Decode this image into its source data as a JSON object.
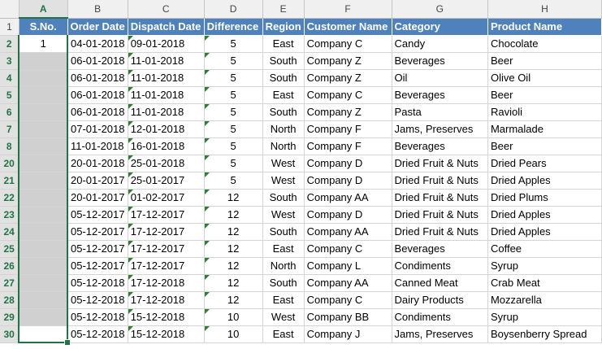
{
  "columns": [
    "A",
    "B",
    "C",
    "D",
    "E",
    "F",
    "G",
    "H"
  ],
  "header_row_number": "1",
  "headers": [
    "S.No.",
    "Order Date",
    "Dispatch Date",
    "Difference",
    "Region",
    "Customer Name",
    "Category",
    "Product Name"
  ],
  "rows": [
    {
      "rownum": "2",
      "sno": "1",
      "order": "04-01-2018",
      "dispatch": "09-01-2018",
      "diff": "5",
      "region": "East",
      "customer": "Company C",
      "category": "Candy",
      "product": "Chocolate"
    },
    {
      "rownum": "3",
      "sno": "",
      "order": "06-01-2018",
      "dispatch": "11-01-2018",
      "diff": "5",
      "region": "South",
      "customer": "Company Z",
      "category": "Beverages",
      "product": "Beer"
    },
    {
      "rownum": "4",
      "sno": "",
      "order": "06-01-2018",
      "dispatch": "11-01-2018",
      "diff": "5",
      "region": "South",
      "customer": "Company Z",
      "category": "Oil",
      "product": "Olive Oil"
    },
    {
      "rownum": "5",
      "sno": "",
      "order": "06-01-2018",
      "dispatch": "11-01-2018",
      "diff": "5",
      "region": "East",
      "customer": "Company C",
      "category": "Beverages",
      "product": "Beer"
    },
    {
      "rownum": "6",
      "sno": "",
      "order": "06-01-2018",
      "dispatch": "11-01-2018",
      "diff": "5",
      "region": "South",
      "customer": "Company Z",
      "category": "Pasta",
      "product": "Ravioli"
    },
    {
      "rownum": "7",
      "sno": "",
      "order": "07-01-2018",
      "dispatch": "12-01-2018",
      "diff": "5",
      "region": "North",
      "customer": "Company F",
      "category": "Jams, Preserves",
      "product": "Marmalade"
    },
    {
      "rownum": "8",
      "sno": "",
      "order": "11-01-2018",
      "dispatch": "16-01-2018",
      "diff": "5",
      "region": "North",
      "customer": "Company F",
      "category": "Beverages",
      "product": "Beer"
    },
    {
      "rownum": "20",
      "sno": "",
      "order": "20-01-2018",
      "dispatch": "25-01-2018",
      "diff": "5",
      "region": "West",
      "customer": "Company D",
      "category": "Dried Fruit & Nuts",
      "product": "Dried Pears"
    },
    {
      "rownum": "21",
      "sno": "",
      "order": "20-01-2017",
      "dispatch": "25-01-2017",
      "diff": "5",
      "region": "West",
      "customer": "Company D",
      "category": "Dried Fruit & Nuts",
      "product": "Dried Apples"
    },
    {
      "rownum": "22",
      "sno": "",
      "order": "20-01-2017",
      "dispatch": "01-02-2017",
      "diff": "12",
      "region": "South",
      "customer": "Company AA",
      "category": "Dried Fruit & Nuts",
      "product": "Dried Plums"
    },
    {
      "rownum": "23",
      "sno": "",
      "order": "05-12-2017",
      "dispatch": "17-12-2017",
      "diff": "12",
      "region": "West",
      "customer": "Company D",
      "category": "Dried Fruit & Nuts",
      "product": "Dried Apples"
    },
    {
      "rownum": "24",
      "sno": "",
      "order": "05-12-2017",
      "dispatch": "17-12-2017",
      "diff": "12",
      "region": "South",
      "customer": "Company AA",
      "category": "Dried Fruit & Nuts",
      "product": "Dried Apples"
    },
    {
      "rownum": "25",
      "sno": "",
      "order": "05-12-2017",
      "dispatch": "17-12-2017",
      "diff": "12",
      "region": "East",
      "customer": "Company C",
      "category": "Beverages",
      "product": "Coffee"
    },
    {
      "rownum": "26",
      "sno": "",
      "order": "05-12-2017",
      "dispatch": "17-12-2017",
      "diff": "12",
      "region": "North",
      "customer": "Company L",
      "category": "Condiments",
      "product": "Syrup"
    },
    {
      "rownum": "27",
      "sno": "",
      "order": "05-12-2018",
      "dispatch": "17-12-2018",
      "diff": "12",
      "region": "South",
      "customer": "Company AA",
      "category": "Canned Meat",
      "product": "Crab Meat"
    },
    {
      "rownum": "28",
      "sno": "",
      "order": "05-12-2018",
      "dispatch": "17-12-2018",
      "diff": "12",
      "region": "East",
      "customer": "Company C",
      "category": "Dairy Products",
      "product": "Mozzarella"
    },
    {
      "rownum": "29",
      "sno": "",
      "order": "05-12-2018",
      "dispatch": "15-12-2018",
      "diff": "10",
      "region": "West",
      "customer": "Company BB",
      "category": "Condiments",
      "product": "Syrup"
    },
    {
      "rownum": "30",
      "sno": "",
      "order": "05-12-2018",
      "dispatch": "15-12-2018",
      "diff": "10",
      "region": "East",
      "customer": "Company J",
      "category": "Jams, Preserves",
      "product": "Boysenberry Spread"
    }
  ],
  "selection": {
    "column": "A"
  },
  "colors": {
    "header_fill": "#4f81bd",
    "selection_green": "#217346",
    "selected_fill": "#d0d0d0"
  }
}
